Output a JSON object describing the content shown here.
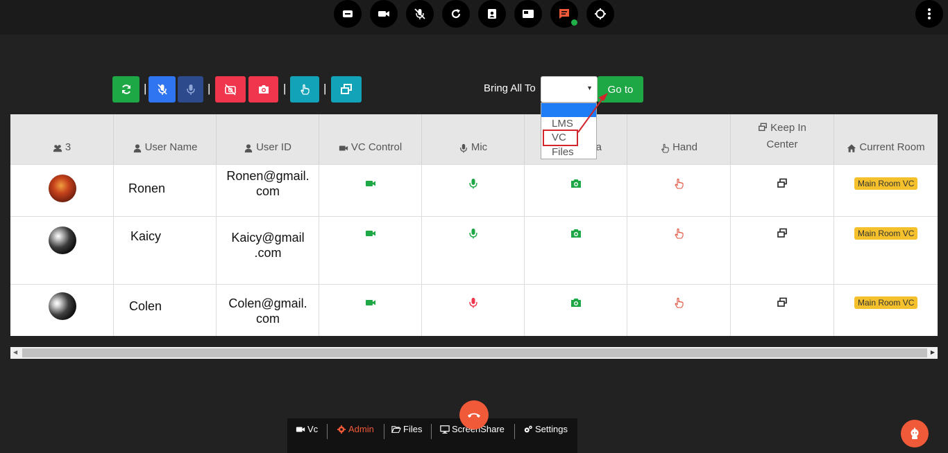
{
  "top_icons": [
    "caption-icon",
    "video-camera-icon",
    "mic-mute-icon",
    "refresh-icon",
    "contact-card-icon",
    "whiteboard-icon",
    "chat-icon",
    "crosshair-icon"
  ],
  "toolbar": {
    "bring_all_to_label": "Bring All To",
    "goto_label": "Go to"
  },
  "dropdown": {
    "options": [
      "",
      "LMS",
      "VC",
      "Files"
    ],
    "highlighted": "VC"
  },
  "table": {
    "headers": {
      "count": "3",
      "user_name": "User Name",
      "user_id": "User ID",
      "vc_control": "VC Control",
      "mic": "Mic",
      "camera_suffix": "a",
      "hand": "Hand",
      "keep_in_center_1": "Keep In",
      "keep_in_center_2": "Center",
      "current_room": "Current Room"
    },
    "rows": [
      {
        "name": "Ronen",
        "id_line1": "Ronen@gmail.",
        "id_line2": "com",
        "mic_status": "on",
        "room": "Main Room VC"
      },
      {
        "name": "Kaicy",
        "id_line1": "Kaicy@gmail",
        "id_line2": ".com",
        "mic_status": "on",
        "room": "Main Room VC"
      },
      {
        "name": "Colen",
        "id_line1": "Colen@gmail.",
        "id_line2": "com",
        "mic_status": "off",
        "room": "Main Room VC"
      }
    ]
  },
  "bottom_nav": {
    "vc": "Vc",
    "admin": "Admin",
    "files": "Files",
    "screenshare": "ScreenShare",
    "settings": "Settings"
  },
  "colors": {
    "green": "#1ea845",
    "blue": "#2f74f0",
    "navy": "#2c4a8c",
    "red": "#f0364c",
    "teal": "#12a3b8",
    "orange": "#f15a38",
    "badge": "#f4c02b",
    "admin_active": "#f15a38"
  }
}
